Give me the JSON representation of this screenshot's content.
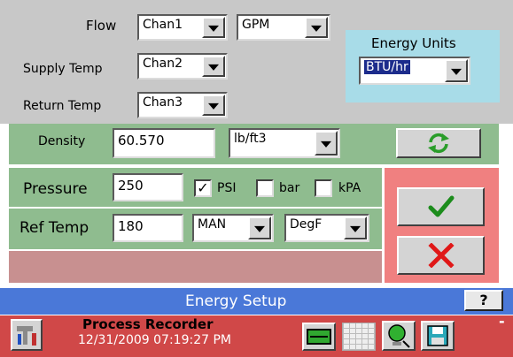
{
  "inputs": {
    "flow_label": "Flow",
    "flow_channel": "Chan1",
    "flow_unit": "GPM",
    "supply_label": "Supply Temp",
    "supply_channel": "Chan2",
    "return_label": "Return Temp",
    "return_channel": "Chan3"
  },
  "energy_units": {
    "label": "Energy Units",
    "value": "BTU/hr"
  },
  "density": {
    "label": "Density",
    "value": "60.570",
    "unit": "lb/ft3"
  },
  "pressure": {
    "label": "Pressure",
    "value": "250",
    "options": [
      {
        "label": "PSI",
        "checked": true
      },
      {
        "label": "bar",
        "checked": false
      },
      {
        "label": "kPA",
        "checked": false
      }
    ]
  },
  "ref_temp": {
    "label": "Ref Temp",
    "value": "180",
    "mode": "MAN",
    "unit": "DegF"
  },
  "title_bar": {
    "title": "Energy Setup",
    "help_label": "?"
  },
  "status_bar": {
    "app_name": "Process Recorder",
    "datetime": "12/31/2009 07:19:27 PM",
    "minimize_label": "-"
  },
  "colors": {
    "panel_gray": "#c8c8c8",
    "green_band": "#8fbc8f",
    "energy_box": "#a8dce8",
    "red_panel": "#f08080",
    "blank_band": "#c89090",
    "title_blue": "#4a78d8",
    "status_red": "#d04848"
  }
}
